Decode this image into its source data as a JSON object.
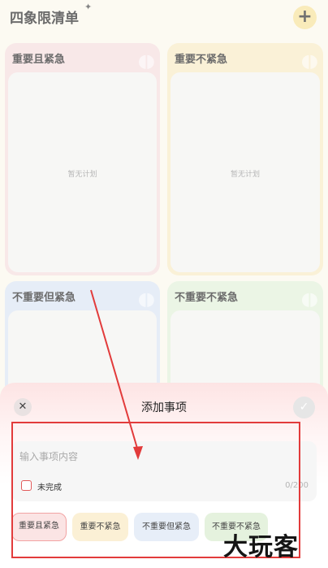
{
  "header": {
    "title": "四象限清单",
    "sparkle": "✦",
    "add_icon": "+"
  },
  "quadrants": [
    {
      "title": "重要且紧急",
      "empty_text": "暂无计划",
      "color": "#f6dfe0"
    },
    {
      "title": "重要不紧急",
      "empty_text": "暂无计划",
      "color": "#f8ecc8"
    },
    {
      "title": "不重要但紧急",
      "empty_text": "",
      "color": "#dde6f4"
    },
    {
      "title": "不重要不紧急",
      "empty_text": "",
      "color": "#e4f2dc"
    }
  ],
  "sheet": {
    "close_icon": "✕",
    "title": "添加事项",
    "confirm_icon": "✓",
    "input_placeholder": "输入事项内容",
    "input_value": "",
    "checkbox_label": "未完成",
    "counter": "0/200",
    "chips": [
      {
        "label": "重要且紧急",
        "selected": true
      },
      {
        "label": "重要不紧急",
        "selected": false
      },
      {
        "label": "不重要但紧急",
        "selected": false
      },
      {
        "label": "不重要不紧急",
        "selected": false
      }
    ]
  },
  "annotation": {
    "color": "#e23b3b"
  },
  "watermark": {
    "text": "大玩客"
  }
}
